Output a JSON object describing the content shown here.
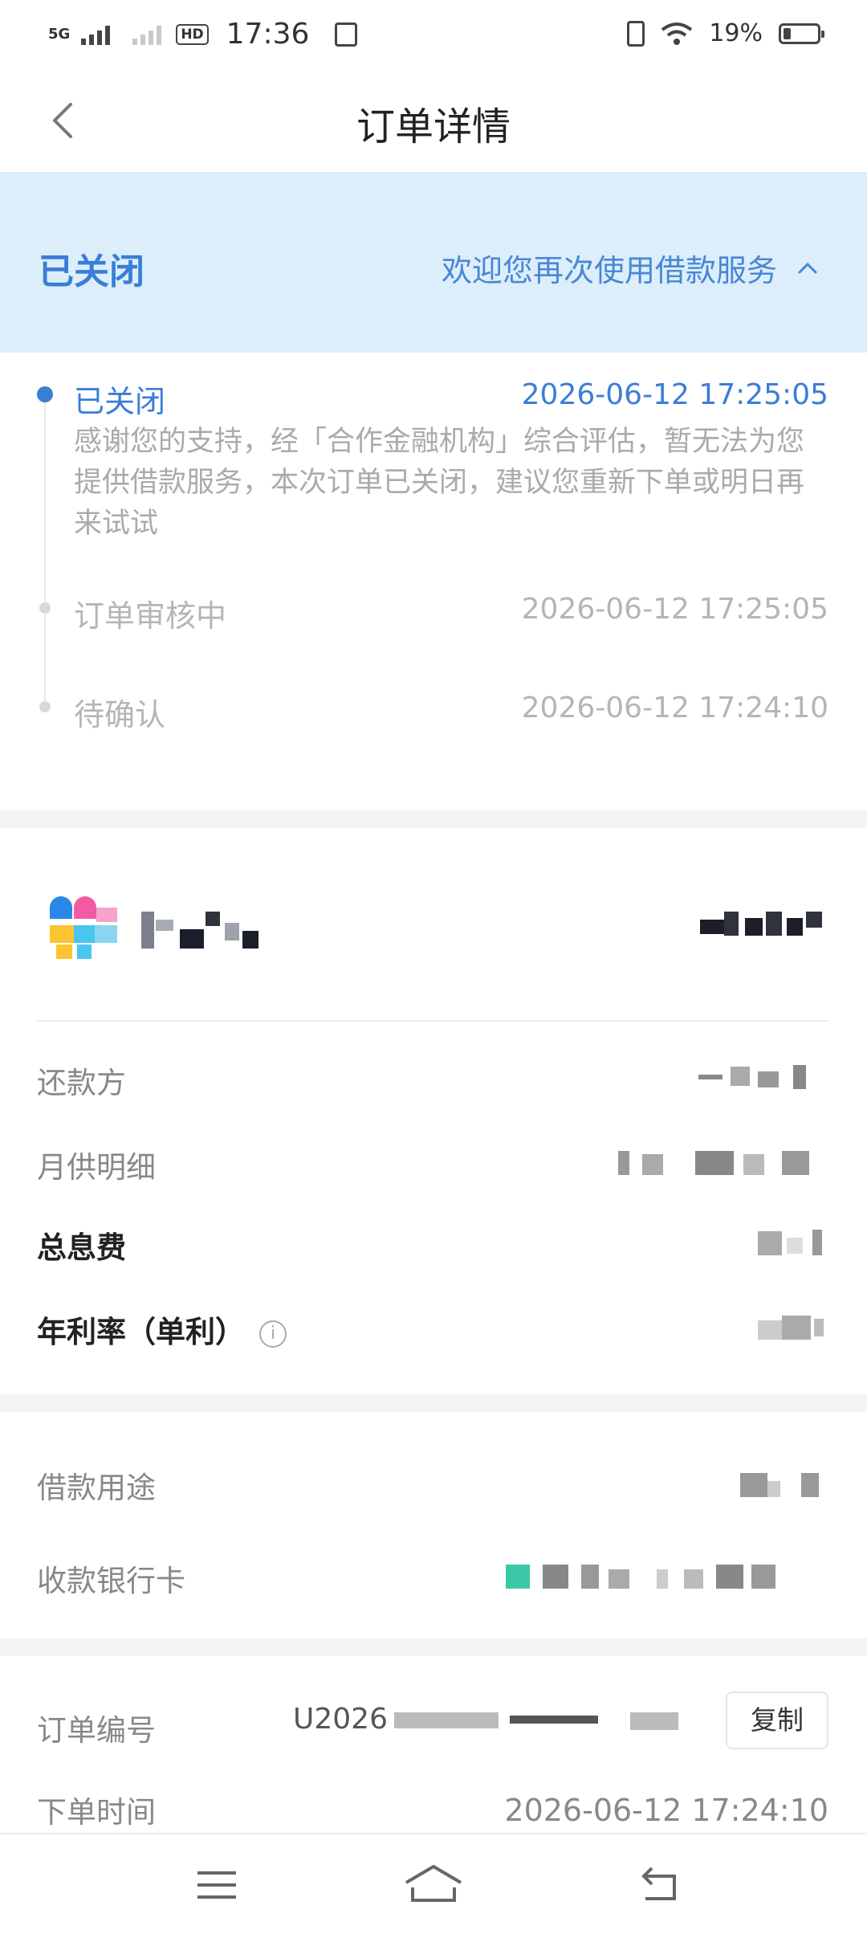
{
  "status_bar": {
    "network": "5G",
    "hd": "HD",
    "time": "17:36",
    "battery_percent": "19%",
    "battery_level": 0.19
  },
  "header": {
    "title": "订单详情",
    "back_icon": "chevron-left-icon"
  },
  "banner": {
    "status": "已关闭",
    "message": "欢迎您再次使用借款服务",
    "toggle_icon": "chevron-up-icon",
    "background": "#dbeefa",
    "accent": "#3b7ed6"
  },
  "timeline": [
    {
      "label": "已关闭",
      "time": "2026-06-12 17:25:05",
      "description": "感谢您的支持，经「合作金融机构」综合评估，暂无法为您提供借款服务，本次订单已关闭，建议您重新下单或明日再来试试",
      "active": true
    },
    {
      "label": "订单审核中",
      "time": "2026-06-12 17:25:05",
      "active": false
    },
    {
      "label": "待确认",
      "time": "2026-06-12 17:24:10",
      "active": false
    }
  ],
  "loan_details": {
    "rows": [
      {
        "label": "还款方"
      },
      {
        "label": "月供明细"
      },
      {
        "label": "总息费"
      },
      {
        "label": "年利率（单利）"
      }
    ],
    "info_icon": "info-icon"
  },
  "extra_info": {
    "purpose_label": "借款用途",
    "bank_card_label": "收款银行卡"
  },
  "order_info": {
    "order_number_label": "订单编号",
    "order_number_partial": "U2026",
    "copy_label": "复制",
    "order_time_label": "下单时间",
    "order_time": "2026-06-12 17:24:10"
  },
  "nav_bar": {
    "menu_icon": "menu-icon",
    "home_icon": "home-icon",
    "back_icon": "back-icon"
  }
}
